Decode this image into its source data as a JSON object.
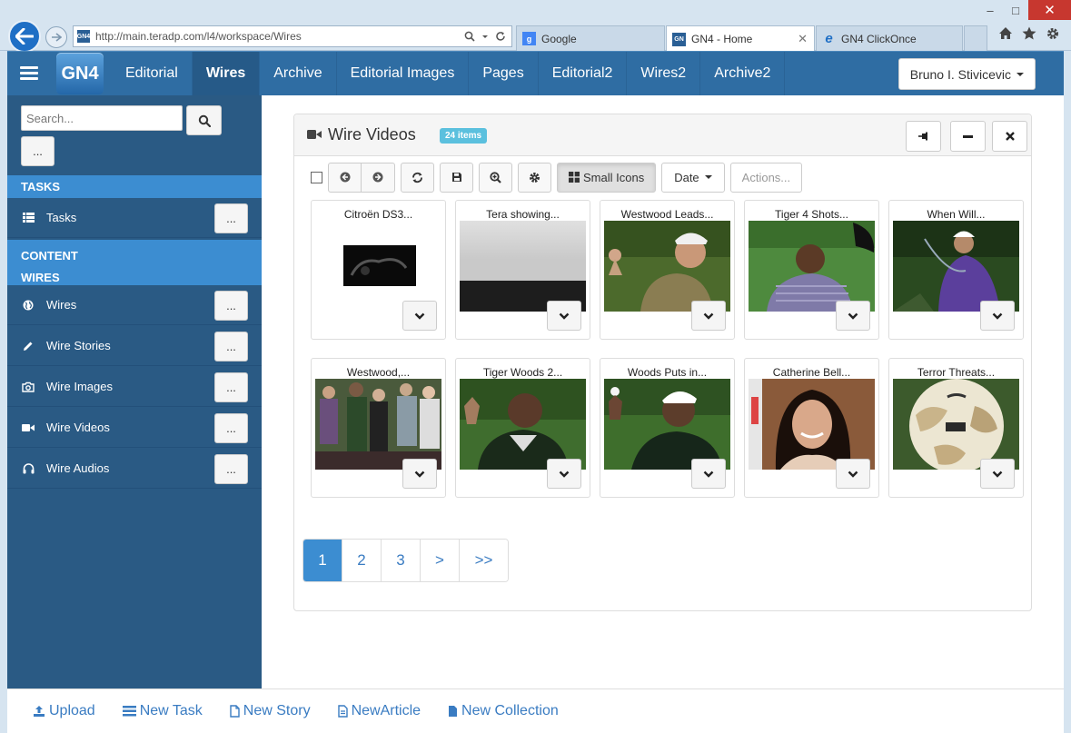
{
  "browser": {
    "url": "http://main.teradp.com/l4/workspace/Wires",
    "tabs": [
      {
        "label": "Google",
        "favicon_color": "#4285f4",
        "favicon_text": "g"
      },
      {
        "label": "GN4 - Home",
        "favicon_color": "#2a5f95",
        "favicon_text": "GN"
      },
      {
        "label": "GN4 ClickOnce",
        "favicon_color": "#f2b01e",
        "favicon_text": "e"
      }
    ],
    "controls": {
      "minimize": "–",
      "maximize": "□",
      "close": "✕"
    }
  },
  "app": {
    "logo_text": "GN4",
    "nav_tabs": [
      "Editorial",
      "Wires",
      "Archive",
      "Editorial Images",
      "Pages",
      "Editorial2",
      "Wires2",
      "Archive2"
    ],
    "active_tab": "Wires",
    "user_name": "Bruno I. Stivicevic",
    "accent_color": "#3c8dd1",
    "header_color": "#2f6da3",
    "sidebar_color": "#2a5a84"
  },
  "sidebar": {
    "search_placeholder": "Search...",
    "more_label": "...",
    "sections": {
      "tasks": "TASKS",
      "content": "CONTENT",
      "wires": "WIRES"
    },
    "items": [
      {
        "label": "Tasks",
        "icon": "list-icon",
        "more": "..."
      },
      {
        "label": "Wires",
        "icon": "globe-icon",
        "more": "..."
      },
      {
        "label": "Wire Stories",
        "icon": "pencil-icon",
        "more": "..."
      },
      {
        "label": "Wire Images",
        "icon": "camera-icon",
        "more": "..."
      },
      {
        "label": "Wire Videos",
        "icon": "video-camera-icon",
        "more": "..."
      },
      {
        "label": "Wire Audios",
        "icon": "headphones-icon",
        "more": "..."
      }
    ]
  },
  "panel": {
    "title": "Wire Videos",
    "badge": "24 items",
    "toolbar": {
      "view_label": "Small Icons",
      "sort_label": "Date",
      "actions_label": "Actions..."
    },
    "items": [
      {
        "title": "Citroën DS3...",
        "thumb": "dark-car"
      },
      {
        "title": "Tera showing...",
        "thumb": "gray-screen"
      },
      {
        "title": "Westwood Leads...",
        "thumb": "golfer-ping"
      },
      {
        "title": "Tiger 4 Shots...",
        "thumb": "golfer-cap"
      },
      {
        "title": "When Will...",
        "thumb": "golfer-swing"
      },
      {
        "title": "Westwood,...",
        "thumb": "crowd"
      },
      {
        "title": "Tiger Woods 2...",
        "thumb": "golfer-vest"
      },
      {
        "title": "Woods Puts in...",
        "thumb": "golfer-ball"
      },
      {
        "title": "Catherine Bell...",
        "thumb": "woman-smile"
      },
      {
        "title": "Terror Threats...",
        "thumb": "soccer-ball"
      }
    ],
    "pagination": [
      "1",
      "2",
      "3",
      ">",
      ">>"
    ],
    "current_page": "1"
  },
  "bottom_bar": {
    "links": [
      {
        "label": "Upload",
        "icon": "upload-icon"
      },
      {
        "label": "New Task",
        "icon": "task-list-icon"
      },
      {
        "label": "New Story",
        "icon": "document-icon"
      },
      {
        "label": "NewArticle",
        "icon": "article-icon"
      },
      {
        "label": "New Collection",
        "icon": "collection-icon"
      }
    ]
  }
}
